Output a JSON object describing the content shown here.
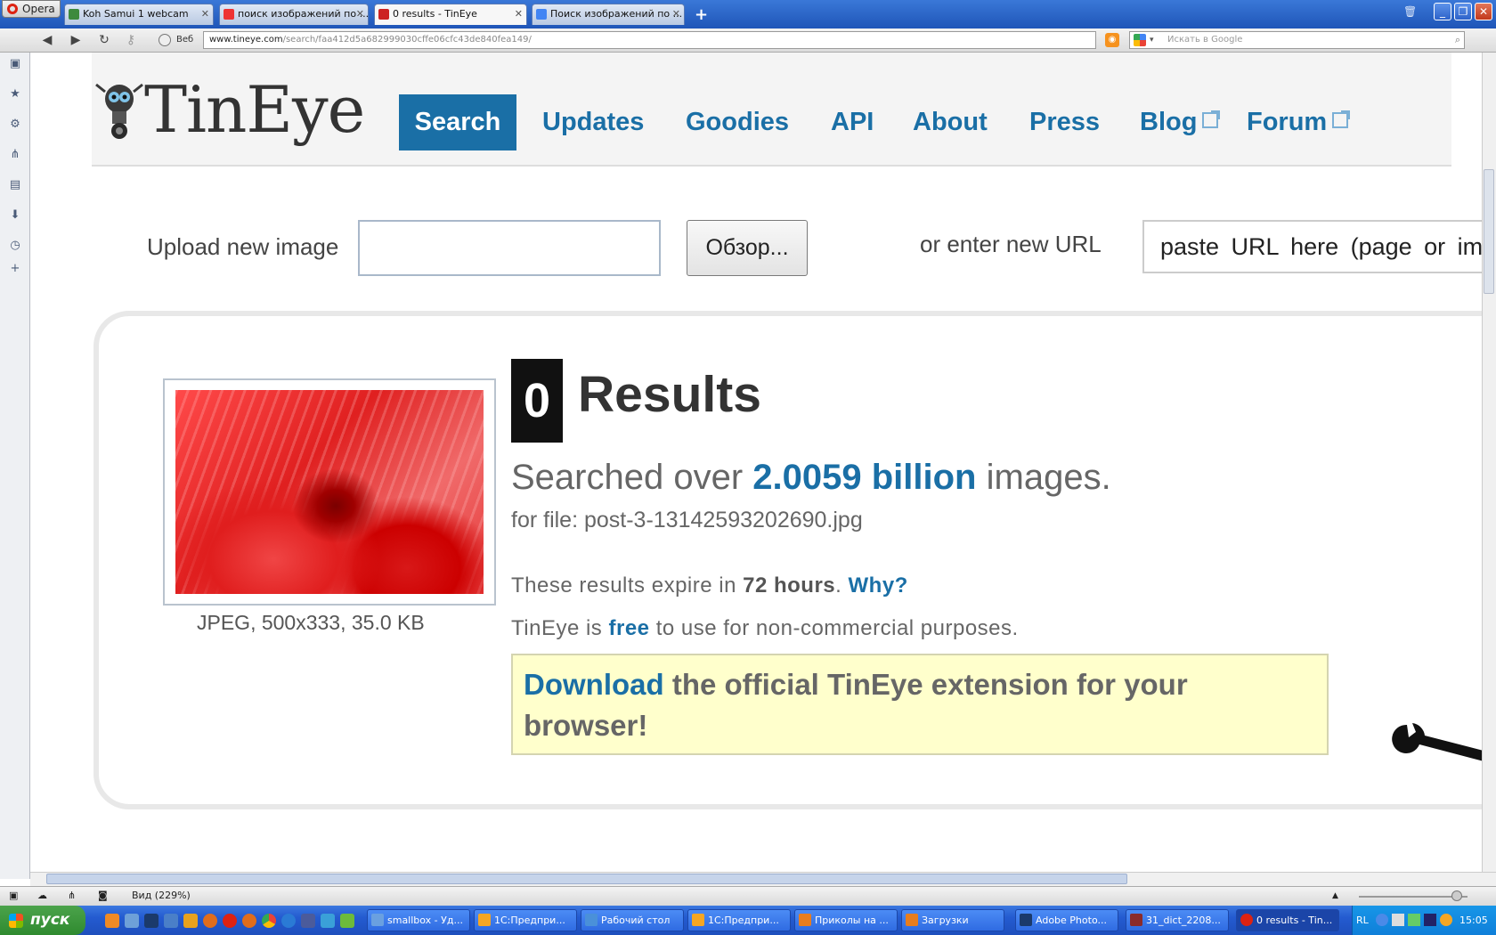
{
  "browser": {
    "opera_label": "Opera",
    "tabs": [
      {
        "label": "Koh Samui 1 webcam",
        "color": "#3d8a3d"
      },
      {
        "label": "поиск изображений по ...",
        "color": "#e33"
      },
      {
        "label": "0 results - TinEye",
        "color": "#c22"
      },
      {
        "label": "Поиск изображений по ...",
        "color": "#4285f4"
      }
    ],
    "active_tab": 2,
    "web_label": "Веб",
    "url_host": "www.tineye.com",
    "url_path": "/search/faa412d5a682999030cffe06cfc43de840fea149/",
    "search_placeholder": "Искать в Google",
    "status_zoom": "Вид (229%)"
  },
  "page": {
    "logo_text": "TinEye",
    "nav": [
      "Search",
      "Updates",
      "Goodies",
      "API",
      "About",
      "Press",
      "Blog",
      "Forum"
    ],
    "upload_label": "Upload new image",
    "browse_label": "Обзор...",
    "url_label": "or enter new URL",
    "url_placeholder": "paste URL here (page or im",
    "thumb_meta": "JPEG, 500x333, 35.0 KB",
    "result_count": "0",
    "results_word": "Results",
    "searched_pre": "Searched over",
    "searched_num": "2.0059 billion",
    "searched_post": "images.",
    "for_file": "for file: post-3-13142593202690.jpg",
    "expire_pre": "These results expire in",
    "expire_hours": "72 hours",
    "expire_dot": ".",
    "expire_why": "Why?",
    "free_pre": "TinEye is",
    "free_word": "free",
    "free_post": "to use for non-commercial purposes.",
    "download_link": "Download",
    "download_rest": "the official TinEye extension for your browser!"
  },
  "taskbar": {
    "start_label": "пуск",
    "buttons": [
      {
        "label": "smallbox - Уд...",
        "color": "#6aa0e0"
      },
      {
        "label": "1С:Предпри...",
        "color": "#f6a623"
      },
      {
        "label": "Рабочий стол",
        "color": "#4a90d9"
      },
      {
        "label": "1С:Предпри...",
        "color": "#f6a623"
      },
      {
        "label": "Приколы на ...",
        "color": "#e87d1e"
      },
      {
        "label": "Загрузки",
        "color": "#e87d1e"
      },
      {
        "label": "Adobe Photo...",
        "color": "#1b3a6b"
      },
      {
        "label": "31_dict_2208...",
        "color": "#8b2b2b"
      },
      {
        "label": "0 results - Tin...",
        "color": "#d21"
      }
    ],
    "active_button": 8,
    "lang": "RL",
    "clock": "15:05"
  },
  "colors": {
    "accent": "#1a6fa6",
    "download_bg": "#ffffcc"
  }
}
